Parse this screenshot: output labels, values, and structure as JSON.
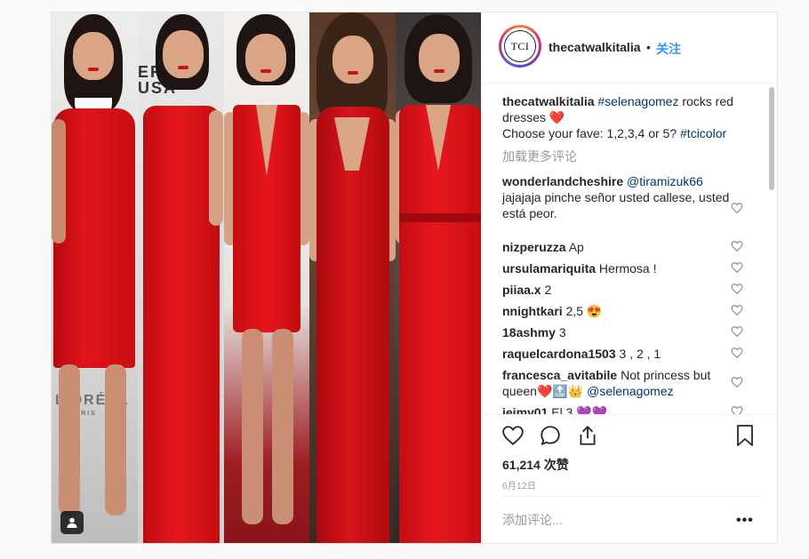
{
  "post": {
    "username": "thecatwalkitalia",
    "avatar_text": "TCI",
    "separator": "•",
    "follow_label": "关注",
    "caption": {
      "username": "thecatwalkitalia",
      "hashtag1": "#selenagomez",
      "text1": " rocks red dresses ",
      "emoji1": "❤️",
      "line2": "Choose your fave: 1,2,3,4 or 5? ",
      "hashtag2": "#tcicolor"
    },
    "load_more_label": "加载更多评论",
    "comments": [
      {
        "user": "wonderlandcheshire",
        "mention": "@tiramizuk66",
        "text": "jajajaja pinche señor usted callese, usted está peor."
      },
      {
        "user": "nizperuzza",
        "text": "Ap"
      },
      {
        "user": "ursulamariquita",
        "text": "Hermosa !"
      },
      {
        "user": "piiaa.x",
        "text": "2"
      },
      {
        "user": "nnightkari",
        "text": "2,5",
        "emoji": "😍"
      },
      {
        "user": "18ashmy",
        "text": "3"
      },
      {
        "user": "raquelcardona1503",
        "text": "3 , 2 , 1"
      },
      {
        "user": "francesca_avitabile",
        "text": "Not princess but queen",
        "emoji": "❤️🔝👑",
        "mention": "@selenagomez"
      },
      {
        "user": "jeimy01",
        "text": "El 3",
        "emoji": "💜💜"
      }
    ],
    "likes_count": "61,214",
    "likes_suffix": " 次赞",
    "date": "6月12日",
    "add_comment_placeholder": "添加评论...",
    "more_label": "•••"
  },
  "collage": {
    "panel1_logo": "L'ORÉAL",
    "panel1_logo_sub": "PARIS",
    "panel2_logo": "ERIC USA",
    "dress_color": "#d40f14"
  },
  "icons": {
    "heart": "heart-icon",
    "comment": "comment-icon",
    "share": "share-icon",
    "save": "bookmark-icon",
    "user_tag": "user-tag-icon"
  }
}
